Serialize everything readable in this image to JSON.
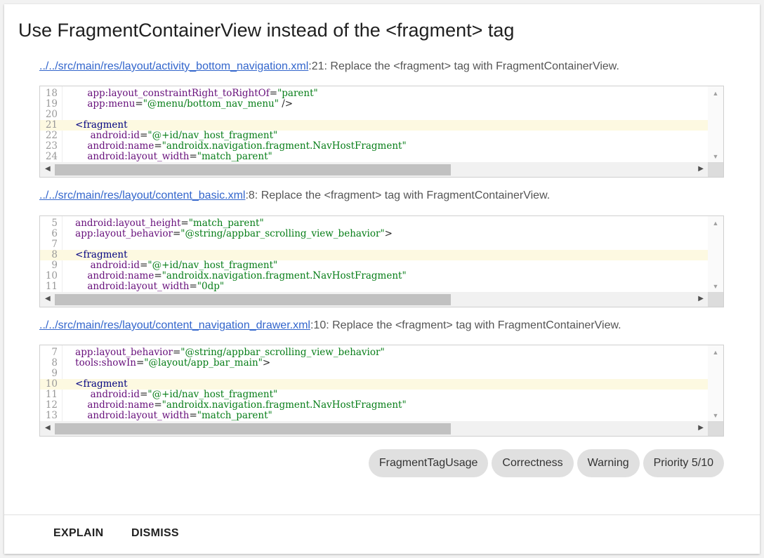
{
  "title": "Use FragmentContainerView instead of the <fragment> tag",
  "issues": [
    {
      "file": "../../src/main/res/layout/activity_bottom_navigation.xml",
      "line_ref": ":21",
      "message": ": Replace the <fragment> tag with FragmentContainerView.",
      "lines": [
        {
          "n": "18",
          "indent": "        ",
          "parts": [
            {
              "t": "app:layout_constraintRight_toRightOf",
              "c": "attr"
            },
            {
              "t": "=",
              "c": "plain"
            },
            {
              "t": "\"parent\"",
              "c": "val"
            }
          ],
          "hl": false
        },
        {
          "n": "19",
          "indent": "        ",
          "parts": [
            {
              "t": "app:menu",
              "c": "attr"
            },
            {
              "t": "=",
              "c": "plain"
            },
            {
              "t": "\"@menu/bottom_nav_menu\"",
              "c": "val"
            },
            {
              "t": " />",
              "c": "plain"
            }
          ],
          "hl": false
        },
        {
          "n": "20",
          "indent": "",
          "parts": [],
          "hl": false
        },
        {
          "n": "21",
          "indent": "    ",
          "parts": [
            {
              "t": "<fragment",
              "c": "tag"
            }
          ],
          "hl": true
        },
        {
          "n": "22",
          "indent": "         ",
          "parts": [
            {
              "t": "android:id",
              "c": "attr"
            },
            {
              "t": "=",
              "c": "plain"
            },
            {
              "t": "\"@+id/nav_host_fragment\"",
              "c": "val"
            }
          ],
          "hl": false
        },
        {
          "n": "23",
          "indent": "        ",
          "parts": [
            {
              "t": "android:name",
              "c": "attr"
            },
            {
              "t": "=",
              "c": "plain"
            },
            {
              "t": "\"androidx.navigation.fragment.NavHostFragment\"",
              "c": "val"
            }
          ],
          "hl": false
        },
        {
          "n": "24",
          "indent": "        ",
          "parts": [
            {
              "t": "android:layout_width",
              "c": "attr"
            },
            {
              "t": "=",
              "c": "plain"
            },
            {
              "t": "\"match_parent\"",
              "c": "val"
            }
          ],
          "hl": false
        }
      ]
    },
    {
      "file": "../../src/main/res/layout/content_basic.xml",
      "line_ref": ":8",
      "message": ": Replace the <fragment> tag with FragmentContainerView.",
      "lines": [
        {
          "n": "5",
          "indent": "    ",
          "parts": [
            {
              "t": "android:layout_height",
              "c": "attr"
            },
            {
              "t": "=",
              "c": "plain"
            },
            {
              "t": "\"match_parent\"",
              "c": "val"
            }
          ],
          "hl": false
        },
        {
          "n": "6",
          "indent": "    ",
          "parts": [
            {
              "t": "app:layout_behavior",
              "c": "attr"
            },
            {
              "t": "=",
              "c": "plain"
            },
            {
              "t": "\"@string/appbar_scrolling_view_behavior\"",
              "c": "val"
            },
            {
              "t": ">",
              "c": "plain"
            }
          ],
          "hl": false
        },
        {
          "n": "7",
          "indent": "",
          "parts": [],
          "hl": false
        },
        {
          "n": "8",
          "indent": "    ",
          "parts": [
            {
              "t": "<fragment",
              "c": "tag"
            }
          ],
          "hl": true
        },
        {
          "n": "9",
          "indent": "         ",
          "parts": [
            {
              "t": "android:id",
              "c": "attr"
            },
            {
              "t": "=",
              "c": "plain"
            },
            {
              "t": "\"@+id/nav_host_fragment\"",
              "c": "val"
            }
          ],
          "hl": false
        },
        {
          "n": "10",
          "indent": "        ",
          "parts": [
            {
              "t": "android:name",
              "c": "attr"
            },
            {
              "t": "=",
              "c": "plain"
            },
            {
              "t": "\"androidx.navigation.fragment.NavHostFragment\"",
              "c": "val"
            }
          ],
          "hl": false
        },
        {
          "n": "11",
          "indent": "        ",
          "parts": [
            {
              "t": "android:layout_width",
              "c": "attr"
            },
            {
              "t": "=",
              "c": "plain"
            },
            {
              "t": "\"0dp\"",
              "c": "val"
            }
          ],
          "hl": false
        }
      ]
    },
    {
      "file": "../../src/main/res/layout/content_navigation_drawer.xml",
      "line_ref": ":10",
      "message": ": Replace the <fragment> tag with FragmentContainerView.",
      "lines": [
        {
          "n": "7",
          "indent": "    ",
          "parts": [
            {
              "t": "app:layout_behavior",
              "c": "attr"
            },
            {
              "t": "=",
              "c": "plain"
            },
            {
              "t": "\"@string/appbar_scrolling_view_behavior\"",
              "c": "val"
            }
          ],
          "hl": false
        },
        {
          "n": "8",
          "indent": "    ",
          "parts": [
            {
              "t": "tools:showIn",
              "c": "attr"
            },
            {
              "t": "=",
              "c": "plain"
            },
            {
              "t": "\"@layout/app_bar_main\"",
              "c": "val"
            },
            {
              "t": ">",
              "c": "plain"
            }
          ],
          "hl": false
        },
        {
          "n": "9",
          "indent": "",
          "parts": [],
          "hl": false
        },
        {
          "n": "10",
          "indent": "    ",
          "parts": [
            {
              "t": "<fragment",
              "c": "tag"
            }
          ],
          "hl": true
        },
        {
          "n": "11",
          "indent": "         ",
          "parts": [
            {
              "t": "android:id",
              "c": "attr"
            },
            {
              "t": "=",
              "c": "plain"
            },
            {
              "t": "\"@+id/nav_host_fragment\"",
              "c": "val"
            }
          ],
          "hl": false
        },
        {
          "n": "12",
          "indent": "        ",
          "parts": [
            {
              "t": "android:name",
              "c": "attr"
            },
            {
              "t": "=",
              "c": "plain"
            },
            {
              "t": "\"androidx.navigation.fragment.NavHostFragment\"",
              "c": "val"
            }
          ],
          "hl": false
        },
        {
          "n": "13",
          "indent": "        ",
          "parts": [
            {
              "t": "android:layout_width",
              "c": "attr"
            },
            {
              "t": "=",
              "c": "plain"
            },
            {
              "t": "\"match_parent\"",
              "c": "val"
            }
          ],
          "hl": false
        }
      ]
    }
  ],
  "chips": [
    "FragmentTagUsage",
    "Correctness",
    "Warning",
    "Priority 5/10"
  ],
  "actions": {
    "explain": "EXPLAIN",
    "dismiss": "DISMISS"
  },
  "icons": {
    "scroll_up": "▲",
    "scroll_down": "▼",
    "scroll_left": "◀",
    "scroll_right": "▶"
  }
}
